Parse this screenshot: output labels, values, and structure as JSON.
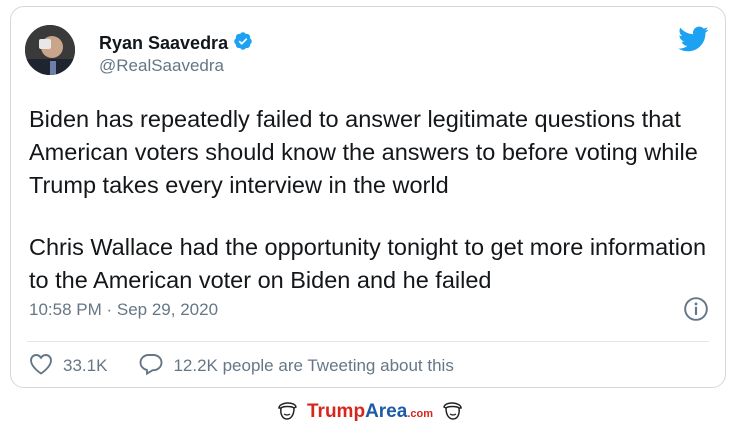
{
  "tweet": {
    "author_name": "Ryan Saavedra",
    "author_handle": "@RealSaavedra",
    "verified": true,
    "paragraphs": [
      "Biden has repeatedly failed to answer legitimate questions that American voters should know the answers to before voting while Trump takes every interview in the world",
      "Chris Wallace had the opportunity tonight to get more information to the American voter on Biden and he failed"
    ],
    "timestamp": "10:58 PM · Sep 29, 2020",
    "like_count": "33.1K",
    "conversation_text": "12.2K people are Tweeting about this"
  },
  "icons": {
    "brand": "twitter-bird-icon",
    "verified": "verified-badge-icon",
    "info": "info-icon",
    "like": "heart-icon",
    "reply": "speech-bubble-icon"
  },
  "watermark": {
    "brand_part1": "Trump",
    "brand_part2": "Area",
    "brand_tld": ".com"
  },
  "colors": {
    "twitter_blue": "#1da1f2",
    "text_primary": "#14171a",
    "text_secondary": "#657786",
    "watermark_red": "#d7261d",
    "watermark_blue": "#1d5aa8"
  }
}
